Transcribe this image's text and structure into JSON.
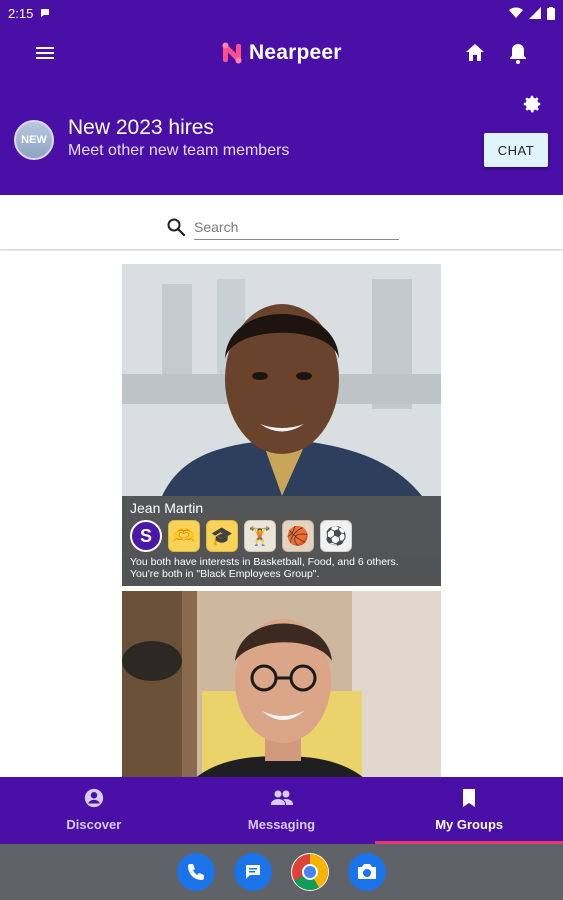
{
  "status_bar": {
    "time": "2:15"
  },
  "app": {
    "name": "Nearpeer"
  },
  "group": {
    "badge": "NEW",
    "title": "New 2023 hires",
    "subtitle": "Meet other new team members",
    "chat_label": "CHAT"
  },
  "search": {
    "placeholder": "Search"
  },
  "cards": [
    {
      "name": "Jean Martin",
      "badges": [
        "S",
        "🫶",
        "🎓",
        "🏋",
        "🏀",
        "⚽"
      ],
      "shared_line1": "You both have interests in Basketball, Food, and 6 others.",
      "shared_line2": "You're both in \"Black Employees Group\"."
    }
  ],
  "bottom_nav": [
    {
      "label": "Discover",
      "icon": "account-circle-icon",
      "active": false
    },
    {
      "label": "Messaging",
      "icon": "people-icon",
      "active": false
    },
    {
      "label": "My Groups",
      "icon": "bookmark-icon",
      "active": true
    }
  ],
  "colors": {
    "primary": "#4a0fa6",
    "chat_button": "#dff5fb",
    "active_indicator": "#e23b6a",
    "system_nav": "#5f6368"
  }
}
